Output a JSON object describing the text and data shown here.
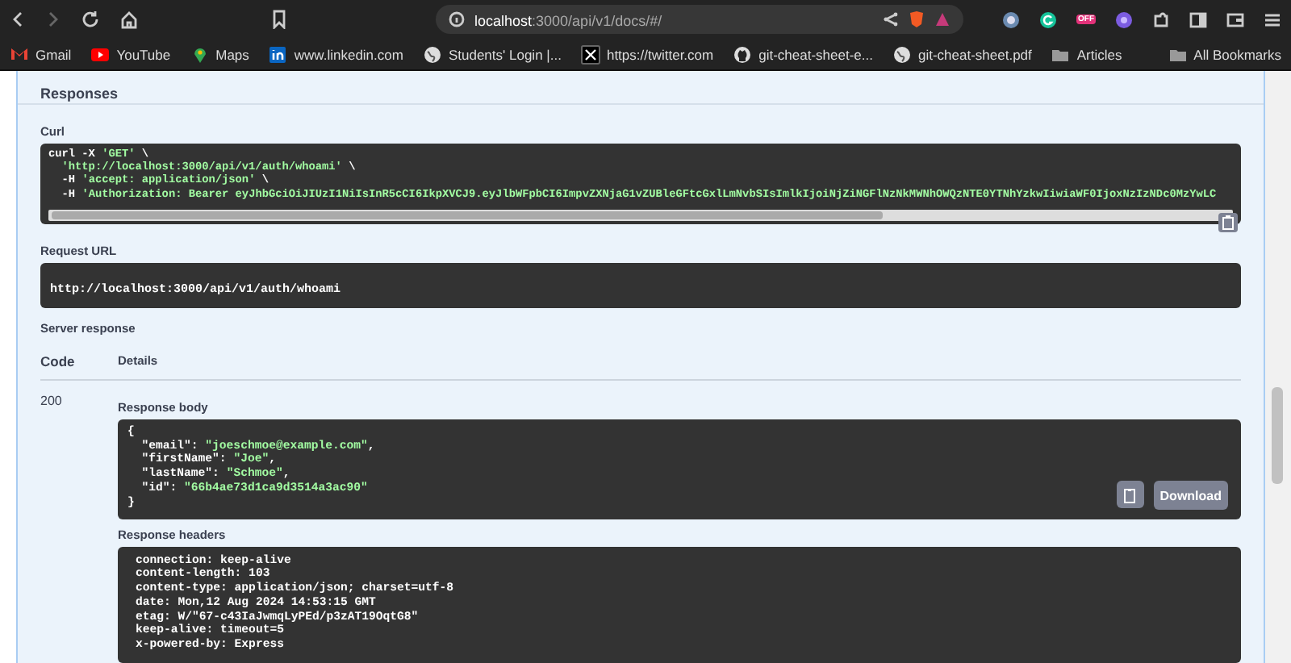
{
  "browser": {
    "url_host": "localhost",
    "url_path": ":3000/api/v1/docs/#/",
    "extension_badge": "OFF"
  },
  "bookmarks": [
    {
      "label": "Gmail",
      "kind": "mail"
    },
    {
      "label": "YouTube",
      "kind": "play"
    },
    {
      "label": "Maps",
      "kind": "pin"
    },
    {
      "label": "www.linkedin.com",
      "kind": "in"
    },
    {
      "label": "Students' Login |...",
      "kind": "globe"
    },
    {
      "label": "https://twitter.com",
      "kind": "x"
    },
    {
      "label": "git-cheat-sheet-e...",
      "kind": "cat"
    },
    {
      "label": "git-cheat-sheet.pdf",
      "kind": "globe"
    },
    {
      "label": "Articles",
      "kind": "folder"
    }
  ],
  "all_bookmarks": "All Bookmarks",
  "responses": {
    "title": "Responses",
    "curl": {
      "label": "Curl",
      "lines": [
        [
          {
            "text": "curl -X ",
            "kind": "plain"
          },
          {
            "text": "'GET'",
            "kind": "string"
          },
          {
            "text": " \\",
            "kind": "plain"
          }
        ],
        [
          {
            "text": "  'http://localhost:3000/api/v1/auth/whoami'",
            "kind": "string"
          },
          {
            "text": " \\",
            "kind": "plain"
          }
        ],
        [
          {
            "text": "  -H ",
            "kind": "plain"
          },
          {
            "text": "'accept: application/json'",
            "kind": "string"
          },
          {
            "text": " \\",
            "kind": "plain"
          }
        ],
        [
          {
            "text": "  -H ",
            "kind": "plain"
          },
          {
            "text": "'Authorization: Bearer eyJhbGciOiJIUzI1NiIsInR5cCI6IkpXVCJ9.eyJlbWFpbCI6ImpvZXNjaG1vZUBleGFtcGxlLmNvbSIsImlkIjoiNjZiNGFlNzNkMWNhOWQzNTE0YTNhYzkwIiwiaWF0IjoxNzIzNDc0MzYwLC",
            "kind": "string"
          }
        ]
      ]
    },
    "request_url": {
      "label": "Request URL",
      "value": "http://localhost:3000/api/v1/auth/whoami"
    },
    "server_response": {
      "label": "Server response",
      "columns": [
        "Code",
        "Details"
      ],
      "code": "200",
      "body_label": "Response body",
      "body_lines": [
        [
          {
            "text": "{",
            "kind": "plain"
          }
        ],
        [
          {
            "text": "  \"email\": ",
            "kind": "plain"
          },
          {
            "text": "\"joeschmoe@example.com\"",
            "kind": "string"
          },
          {
            "text": ",",
            "kind": "plain"
          }
        ],
        [
          {
            "text": "  \"firstName\": ",
            "kind": "plain"
          },
          {
            "text": "\"Joe\"",
            "kind": "string"
          },
          {
            "text": ",",
            "kind": "plain"
          }
        ],
        [
          {
            "text": "  \"lastName\": ",
            "kind": "plain"
          },
          {
            "text": "\"Schmoe\"",
            "kind": "string"
          },
          {
            "text": ",",
            "kind": "plain"
          }
        ],
        [
          {
            "text": "  \"id\": ",
            "kind": "plain"
          },
          {
            "text": "\"66b4ae73d1ca9d3514a3ac90\"",
            "kind": "string"
          }
        ],
        [
          {
            "text": "}",
            "kind": "plain"
          }
        ]
      ],
      "download": "Download",
      "headers_label": "Response headers",
      "header_lines": [
        "connection: keep-alive",
        "content-length: 103",
        "content-type: application/json; charset=utf-8",
        "date: Mon,12 Aug 2024 14:53:15 GMT",
        "etag: W/\"67-c43IaJwmqLyPEd/p3zAT19OqtG8\"",
        "keep-alive: timeout=5",
        "x-powered-by: Express"
      ]
    }
  }
}
